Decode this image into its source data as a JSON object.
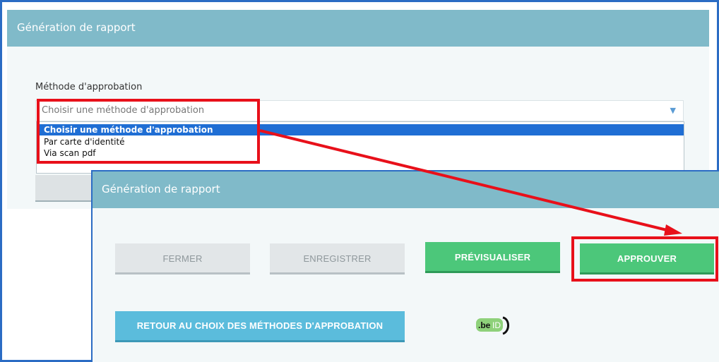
{
  "back_panel": {
    "title": "Génération de rapport",
    "field_label": "Méthode d'approbation",
    "select_value": "Choisir une méthode d'approbation",
    "options": [
      "Choisir une méthode d'approbation",
      "Par carte d'identité",
      "Via scan pdf"
    ]
  },
  "front_panel": {
    "title": "Génération de rapport",
    "buttons": {
      "close": "FERMER",
      "save": "ENREGISTRER",
      "preview": "PRÉVISUALISER",
      "approve": "APPROUVER",
      "back_to_methods": "RETOUR AU CHOIX DES MÉTHODES D'APPROBATION"
    },
    "beid_logo_text": ".beID"
  },
  "colors": {
    "header": "#80bac9",
    "green_button": "#4cc77a",
    "blue_button": "#5bbcdc",
    "highlight": "#e8101a",
    "selected_option": "#1f6ed4"
  }
}
